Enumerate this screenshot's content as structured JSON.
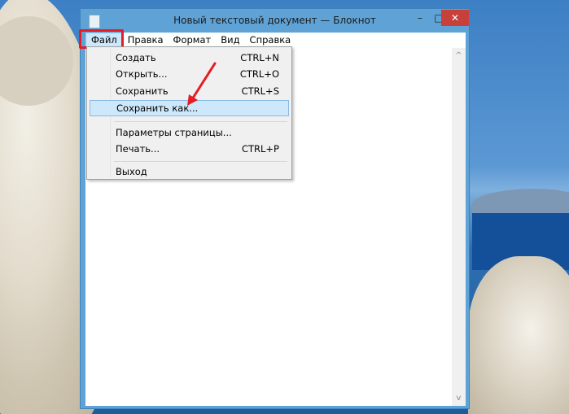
{
  "window": {
    "title": "Новый текстовый документ — Блокнот",
    "minimize_glyph": "–",
    "maximize_glyph": "□",
    "close_glyph": "✕"
  },
  "menubar": {
    "items": [
      {
        "label": "Файл",
        "active": true
      },
      {
        "label": "Правка"
      },
      {
        "label": "Формат"
      },
      {
        "label": "Вид"
      },
      {
        "label": "Справка"
      }
    ]
  },
  "file_menu": {
    "items": [
      {
        "label": "Создать",
        "shortcut": "CTRL+N"
      },
      {
        "label": "Открыть...",
        "shortcut": "CTRL+O"
      },
      {
        "label": "Сохранить",
        "shortcut": "CTRL+S"
      },
      {
        "label": "Сохранить как...",
        "shortcut": "",
        "selected": true
      },
      {
        "label": "Параметры страницы...",
        "shortcut": ""
      },
      {
        "label": "Печать...",
        "shortcut": "CTRL+P"
      },
      {
        "label": "Выход",
        "shortcut": ""
      }
    ]
  },
  "scrollbar": {
    "up_glyph": "^",
    "down_glyph": "v"
  },
  "colors": {
    "annotation": "#e51c23",
    "title_bar": "#5fa3d6",
    "close_button": "#c7403a",
    "selection": "#cde8fb"
  }
}
